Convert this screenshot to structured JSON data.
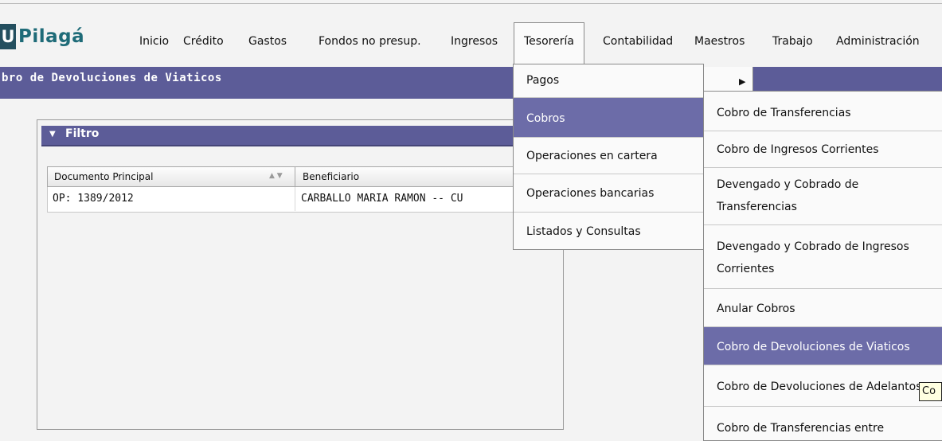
{
  "app": {
    "logo_letter": "U",
    "logo_text": "Pilagá"
  },
  "menu": {
    "items": [
      {
        "label": "Inicio"
      },
      {
        "label": "Crédito"
      },
      {
        "label": "Gastos"
      },
      {
        "label": "Fondos no presup."
      },
      {
        "label": "Ingresos"
      },
      {
        "label": "Tesorería",
        "active": true
      },
      {
        "label": "Contabilidad"
      },
      {
        "label": "Maestros"
      },
      {
        "label": "Trabajo"
      },
      {
        "label": "Administración"
      }
    ]
  },
  "page": {
    "title": "bro de Devoluciones de Viaticos"
  },
  "filter": {
    "label": "Filtro"
  },
  "table": {
    "columns": [
      "Documento Principal",
      "Beneficiario"
    ],
    "rows": [
      {
        "documento": "OP: 1389/2012",
        "beneficiario": "CARBALLO MARIA RAMON -- CU"
      }
    ]
  },
  "tesoreria_menu": {
    "items": [
      {
        "label": "Pagos",
        "has_submenu": true
      },
      {
        "label": "Cobros",
        "selected": true,
        "has_submenu": true
      },
      {
        "label": "Operaciones en cartera"
      },
      {
        "label": "Operaciones bancarias"
      },
      {
        "label": "Listados y Consultas"
      }
    ]
  },
  "cobros_menu": {
    "items": [
      {
        "line1": "Cobro de Transferencias",
        "line2": ""
      },
      {
        "line1": "Cobro de Ingresos Corrientes",
        "line2": ""
      },
      {
        "line1": "Devengado y Cobrado de",
        "line2": "Transferencias"
      },
      {
        "line1": "Devengado y Cobrado de Ingresos",
        "line2": "Corrientes"
      },
      {
        "line1": "Anular Cobros",
        "line2": ""
      },
      {
        "line1": "Cobro de Devoluciones de Viaticos",
        "line2": "",
        "selected": true
      },
      {
        "line1": "Cobro de Devoluciones de Adelantos",
        "line2": ""
      },
      {
        "line1": "Cobro de Transferencias entre",
        "line2": ""
      }
    ]
  },
  "tooltip": {
    "text": "Co"
  },
  "colors": {
    "title_bar": "#5c5c98",
    "selected_item": "#6c6ca8",
    "logo_dark": "#244f5f",
    "logo_text": "#1e6b78",
    "tooltip_bg": "#ffffe1"
  }
}
